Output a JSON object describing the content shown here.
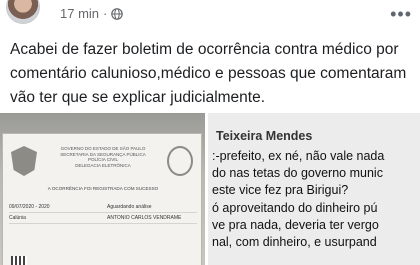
{
  "post": {
    "time": "17 min",
    "separator": "·",
    "text": "Acabei de fazer boletim de ocorrência contra médico por comentário calunioso,médico e pessoas que comentaram vão  ter que se explicar judicialmente."
  },
  "left_photo": {
    "header_lines": [
      "GOVERNO DO ESTADO DE SÃO PAULO",
      "SECRETARIA DA SEGURANÇA PÚBLICA",
      "POLÍCIA CIVIL",
      "DELEGACIA ELETRÔNICA"
    ],
    "title": "A OCORRÊNCIA FOI REGISTRADA COM SUCESSO",
    "rows": [
      [
        "09/07/2020 - 2020",
        "Aguardando análise"
      ],
      [
        "Calúnia",
        "ANTONIO CARLOS VENDRAME"
      ]
    ]
  },
  "right_photo": {
    "author": "Teixeira Mendes",
    "lines": [
      ":-prefeito, ex né, não vale nada",
      "do nas tetas do governo munic",
      "este vice fez pra Birigui?",
      "ó aproveitando do dinheiro pú",
      "ve pra nada, deveria ter vergo",
      "nal, com dinheiro, e usurpand"
    ]
  }
}
